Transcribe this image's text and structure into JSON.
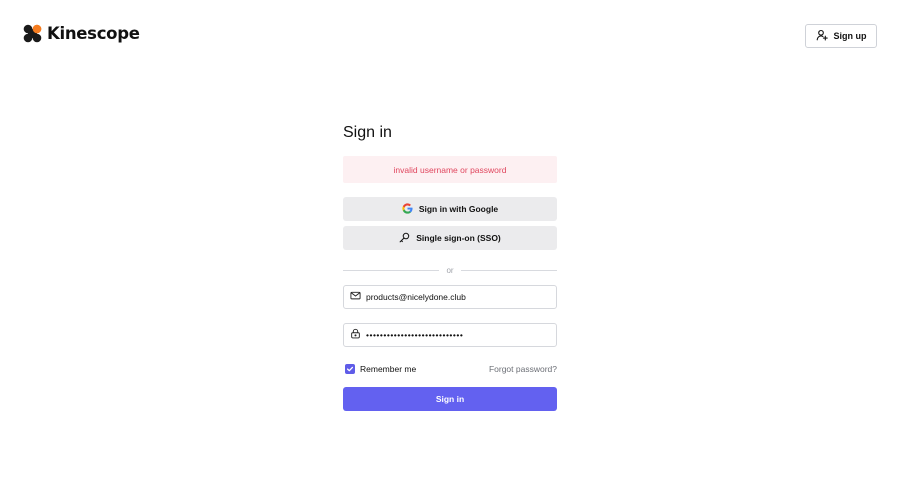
{
  "header": {
    "brand": "Kinescope",
    "signup_label": "Sign up"
  },
  "form": {
    "title": "Sign in",
    "error_message": "invalid username or password",
    "google_button_label": "Sign in with Google",
    "sso_button_label": "Single sign-on (SSO)",
    "divider_text": "or",
    "email_value": "products@nicelydone.club",
    "password_value": "••••••••••••••••••••••••••••",
    "remember_label": "Remember me",
    "remember_checked": true,
    "forgot_label": "Forgot password?",
    "submit_label": "Sign in"
  },
  "colors": {
    "accent": "#6361f0",
    "error_text": "#e0465e",
    "error_bg": "#fdf0f2",
    "logo_dark": "#1a1a1a",
    "logo_orange": "#f57c1f"
  },
  "icons": {
    "google": "google-g-icon",
    "sso": "key-icon",
    "signup": "user-plus-icon",
    "email": "envelope-icon",
    "password": "lock-icon",
    "checkbox": "check-icon"
  }
}
